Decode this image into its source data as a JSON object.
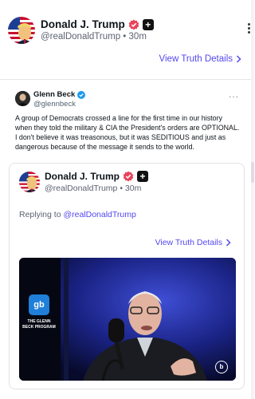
{
  "main_post": {
    "display_name": "Donald J. Trump",
    "handle": "@realDonaldTrump",
    "separator": "•",
    "time": "30m",
    "plus_badge": "+",
    "view_details": "View Truth Details",
    "avatar_icon": "us-flag-portrait-avatar",
    "more_icon": "vertical-ellipsis-icon"
  },
  "tweet": {
    "name": "Glenn Beck",
    "handle": "@glennbeck",
    "more": "···",
    "text": "A group of Democrats crossed a line for the first time in our history when they told the military & CIA the President's orders are OPTIONAL. I don't believe it was treasonous, but it was SEDITIOUS and just as dangerous because of the message it sends to the world."
  },
  "quoted_post": {
    "display_name": "Donald J. Trump",
    "handle": "@realDonaldTrump",
    "separator": "•",
    "time": "30m",
    "plus_badge": "+",
    "replying_prefix": "Replying to",
    "replying_handle": "@realDonaldTrump",
    "view_details": "View Truth Details",
    "video": {
      "logo_short": "gb",
      "logo_caption": "THE GLENN BECK PROGRAM",
      "corner_icon": "b"
    }
  },
  "colors": {
    "accent": "#5448ee",
    "verified": "#e8445a"
  }
}
